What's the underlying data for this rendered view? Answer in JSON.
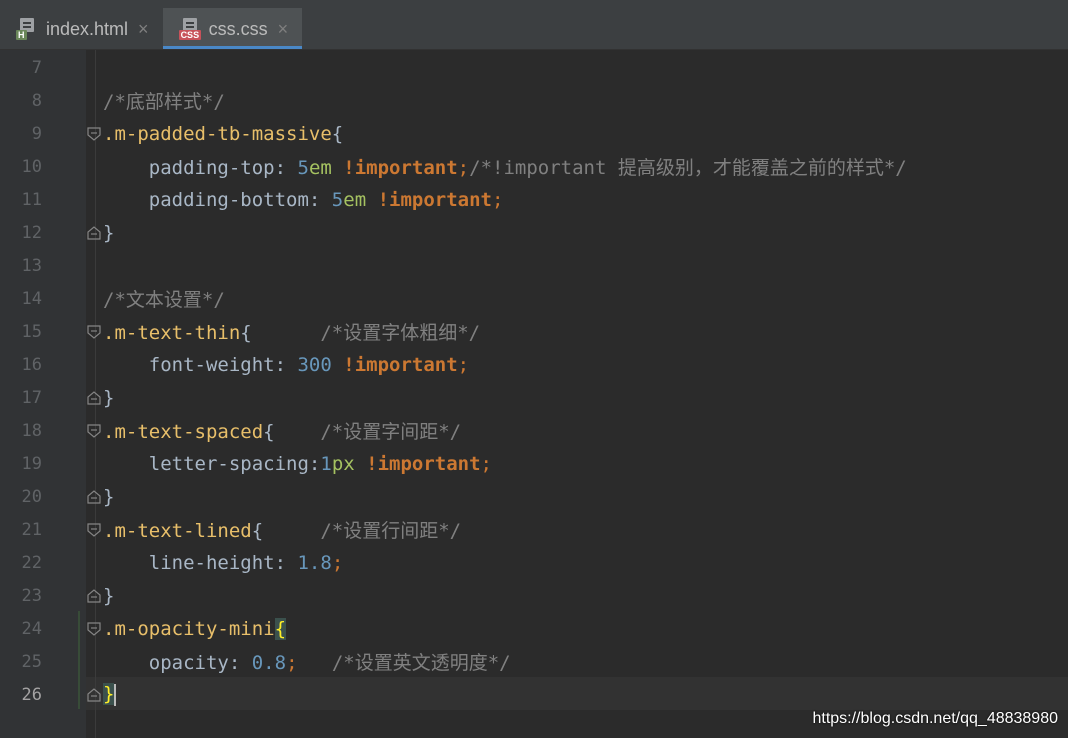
{
  "tabs": [
    {
      "label": "index.html",
      "icon": "html-file-icon",
      "badge": "H",
      "active": false
    },
    {
      "label": "css.css",
      "icon": "css-file-icon",
      "badge": "CSS",
      "active": true
    }
  ],
  "close_glyph": "×",
  "lines": [
    {
      "n": "7",
      "fold": "",
      "parts": []
    },
    {
      "n": "8",
      "fold": "",
      "parts": [
        {
          "t": "/*底部样式*/",
          "c": "comment"
        }
      ]
    },
    {
      "n": "9",
      "fold": "start",
      "parts": [
        {
          "t": ".m-padded-tb-massive",
          "c": "sel"
        },
        {
          "t": "{",
          "c": "prop"
        }
      ]
    },
    {
      "n": "10",
      "fold": "",
      "parts": [
        {
          "t": "    padding-top",
          "c": "prop"
        },
        {
          "t": ": ",
          "c": "prop"
        },
        {
          "t": "5",
          "c": "num"
        },
        {
          "t": "em",
          "c": "unit"
        },
        {
          "t": " !important",
          "c": "imp"
        },
        {
          "t": ";",
          "c": "semi"
        },
        {
          "t": "/*!important 提高级别，才能覆盖之前的样式*/",
          "c": "comment"
        }
      ]
    },
    {
      "n": "11",
      "fold": "",
      "parts": [
        {
          "t": "    padding-bottom",
          "c": "prop"
        },
        {
          "t": ": ",
          "c": "prop"
        },
        {
          "t": "5",
          "c": "num"
        },
        {
          "t": "em",
          "c": "unit"
        },
        {
          "t": " !important",
          "c": "imp"
        },
        {
          "t": ";",
          "c": "semi"
        }
      ]
    },
    {
      "n": "12",
      "fold": "end",
      "parts": [
        {
          "t": "}",
          "c": "prop"
        }
      ]
    },
    {
      "n": "13",
      "fold": "",
      "parts": []
    },
    {
      "n": "14",
      "fold": "",
      "parts": [
        {
          "t": "/*文本设置*/",
          "c": "comment"
        }
      ]
    },
    {
      "n": "15",
      "fold": "start",
      "parts": [
        {
          "t": ".m-text-thin",
          "c": "sel"
        },
        {
          "t": "{      ",
          "c": "prop"
        },
        {
          "t": "/*设置字体粗细*/",
          "c": "comment"
        }
      ]
    },
    {
      "n": "16",
      "fold": "",
      "parts": [
        {
          "t": "    font-weight",
          "c": "prop"
        },
        {
          "t": ": ",
          "c": "prop"
        },
        {
          "t": "300",
          "c": "num"
        },
        {
          "t": " !important",
          "c": "imp"
        },
        {
          "t": ";",
          "c": "semi"
        }
      ]
    },
    {
      "n": "17",
      "fold": "end",
      "parts": [
        {
          "t": "}",
          "c": "prop"
        }
      ]
    },
    {
      "n": "18",
      "fold": "start",
      "parts": [
        {
          "t": ".m-text-spaced",
          "c": "sel"
        },
        {
          "t": "{    ",
          "c": "prop"
        },
        {
          "t": "/*设置字间距*/",
          "c": "comment"
        }
      ]
    },
    {
      "n": "19",
      "fold": "",
      "parts": [
        {
          "t": "    letter-spacing",
          "c": "prop"
        },
        {
          "t": ":",
          "c": "prop"
        },
        {
          "t": "1",
          "c": "num"
        },
        {
          "t": "px",
          "c": "unit"
        },
        {
          "t": " !important",
          "c": "imp"
        },
        {
          "t": ";",
          "c": "semi"
        }
      ]
    },
    {
      "n": "20",
      "fold": "end",
      "parts": [
        {
          "t": "}",
          "c": "prop"
        }
      ]
    },
    {
      "n": "21",
      "fold": "start",
      "parts": [
        {
          "t": ".m-text-lined",
          "c": "sel"
        },
        {
          "t": "{     ",
          "c": "prop"
        },
        {
          "t": "/*设置行间距*/",
          "c": "comment"
        }
      ]
    },
    {
      "n": "22",
      "fold": "",
      "parts": [
        {
          "t": "    line-height",
          "c": "prop"
        },
        {
          "t": ": ",
          "c": "prop"
        },
        {
          "t": "1.8",
          "c": "num"
        },
        {
          "t": ";",
          "c": "semi"
        }
      ]
    },
    {
      "n": "23",
      "fold": "end",
      "parts": [
        {
          "t": "}",
          "c": "prop"
        }
      ]
    },
    {
      "n": "24",
      "fold": "start",
      "parts": [
        {
          "t": ".m-opacity-mini",
          "c": "sel"
        },
        {
          "t": "{",
          "c": "brace-hl"
        }
      ]
    },
    {
      "n": "25",
      "fold": "",
      "parts": [
        {
          "t": "    opacity",
          "c": "prop"
        },
        {
          "t": ": ",
          "c": "prop"
        },
        {
          "t": "0.8",
          "c": "num"
        },
        {
          "t": ";",
          "c": "semi"
        },
        {
          "t": "   ",
          "c": "prop"
        },
        {
          "t": "/*设置英文透明度*/",
          "c": "comment"
        }
      ]
    },
    {
      "n": "26",
      "fold": "end",
      "current": true,
      "parts": [
        {
          "t": "}",
          "c": "brace-hl"
        }
      ]
    }
  ],
  "watermark": "https://blog.csdn.net/qq_48838980",
  "colors": {
    "background": "#2b2b2b",
    "selector": "#e8bf6a",
    "number": "#6897bb",
    "unit": "#a5c261",
    "keyword": "#cc7832",
    "comment": "#808080",
    "text": "#a9b7c6",
    "tab_accent": "#4a88c7"
  }
}
